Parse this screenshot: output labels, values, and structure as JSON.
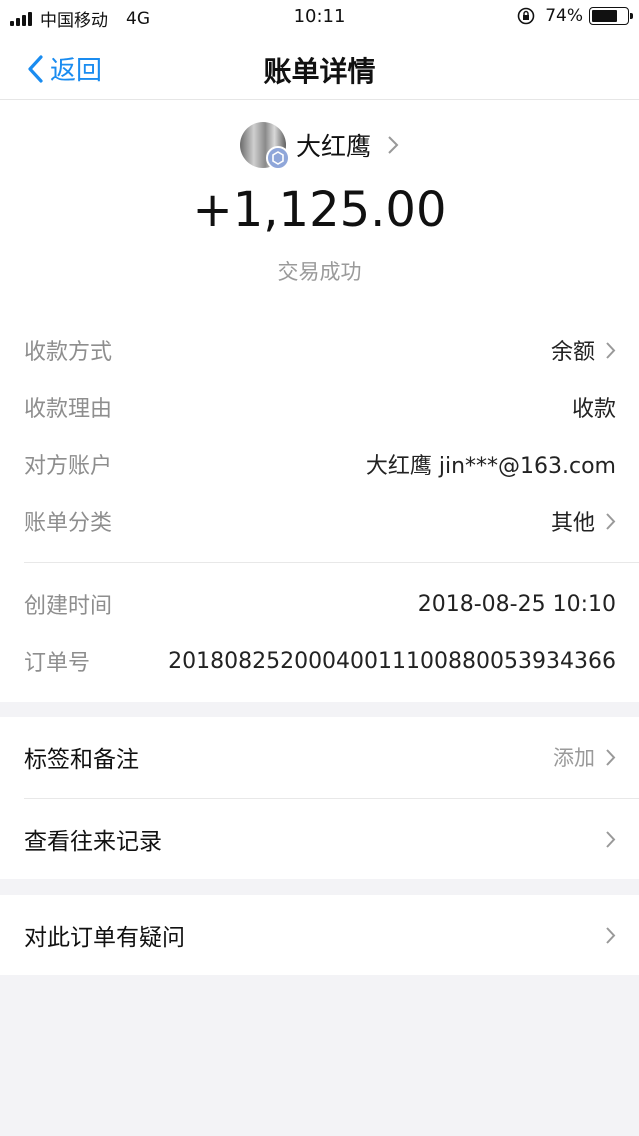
{
  "status_bar": {
    "carrier": "中国移动",
    "network": "4G",
    "time": "10:11",
    "battery_text": "74%",
    "battery_level": 0.74
  },
  "nav": {
    "back_label": "返回",
    "title": "账单详情"
  },
  "summary": {
    "payee_name": "大红鹰",
    "amount": "+1,125.00",
    "status": "交易成功"
  },
  "details": [
    {
      "label": "收款方式",
      "value": "余额"
    },
    {
      "label": "收款理由",
      "value": "收款"
    },
    {
      "label": "对方账户",
      "value": "大红鹰 jin***@163.com"
    },
    {
      "label": "账单分类",
      "value": "其他"
    },
    {
      "label": "创建时间",
      "value": "2018-08-25 10:10"
    },
    {
      "label": "订单号",
      "value": "20180825200040011100880053934366"
    }
  ],
  "actions": {
    "tags_label": "标签和备注",
    "tags_value": "添加",
    "history_label": "查看往来记录",
    "question_label": "对此订单有疑问"
  },
  "colors": {
    "accent": "#1a8cf0",
    "background": "#f3f3f6"
  }
}
